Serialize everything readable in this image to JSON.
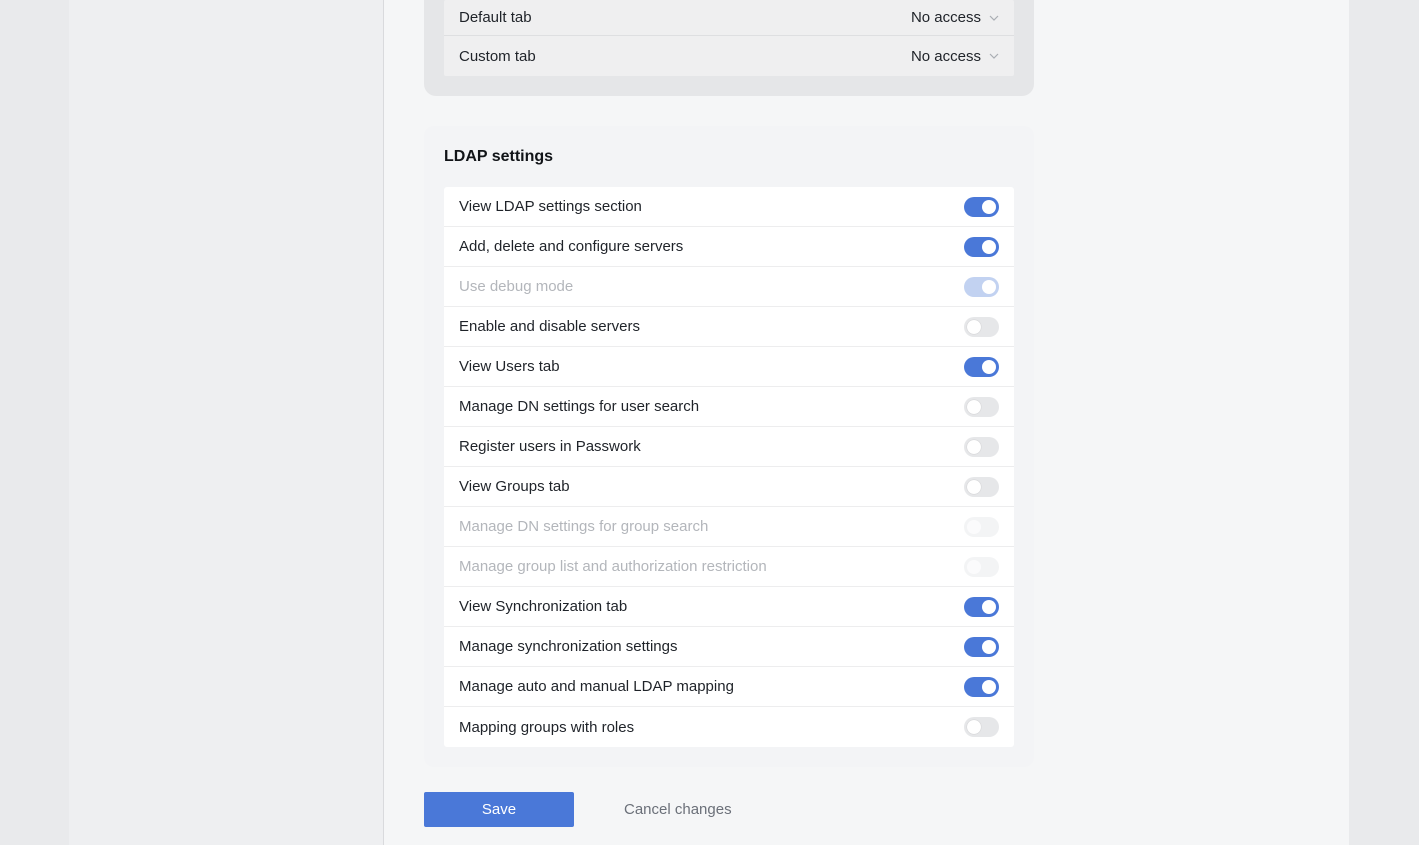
{
  "access_section": {
    "rows": [
      {
        "label": "Default tab",
        "value": "No access"
      },
      {
        "label": "Custom tab",
        "value": "No access"
      }
    ]
  },
  "ldap": {
    "title": "LDAP settings",
    "items": [
      {
        "label": "View LDAP settings section",
        "state": "on"
      },
      {
        "label": "Add, delete and configure servers",
        "state": "on"
      },
      {
        "label": "Use debug mode",
        "state": "on-disabled"
      },
      {
        "label": "Enable and disable servers",
        "state": "off"
      },
      {
        "label": "View Users tab",
        "state": "on"
      },
      {
        "label": "Manage DN settings for user search",
        "state": "off"
      },
      {
        "label": "Register users in Passwork",
        "state": "off"
      },
      {
        "label": "View Groups tab",
        "state": "off"
      },
      {
        "label": "Manage DN settings for group search",
        "state": "off-disabled"
      },
      {
        "label": "Manage group list and authorization restriction",
        "state": "off-disabled"
      },
      {
        "label": "View Synchronization tab",
        "state": "on"
      },
      {
        "label": "Manage synchronization settings",
        "state": "on"
      },
      {
        "label": "Manage auto and manual LDAP mapping",
        "state": "on"
      },
      {
        "label": "Mapping groups with roles",
        "state": "off"
      }
    ]
  },
  "actions": {
    "save_label": "Save",
    "cancel_label": "Cancel changes"
  },
  "colors": {
    "accent": "#4a78d8",
    "toggle_off": "#e6e7e9",
    "toggle_on_disabled": "#c2d2f1"
  }
}
